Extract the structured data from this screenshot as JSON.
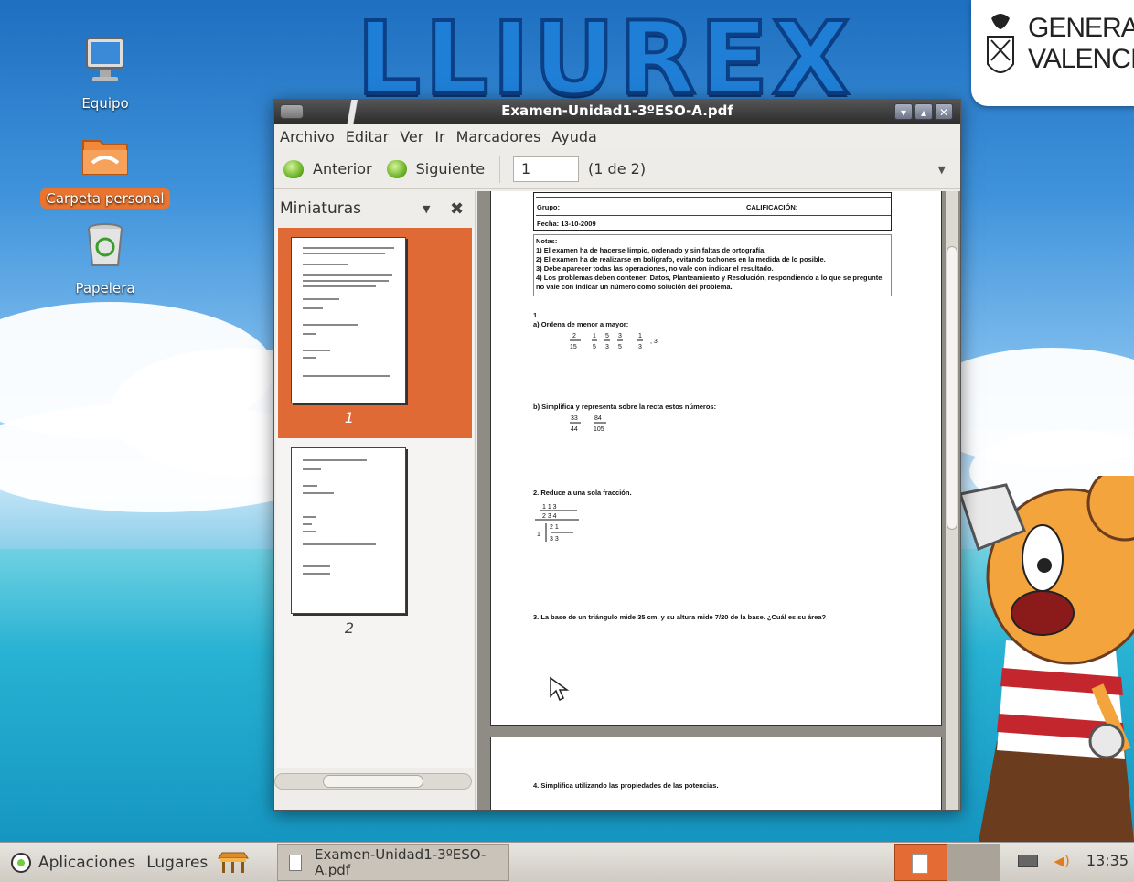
{
  "desktop": {
    "icons": [
      {
        "name": "equipo",
        "label": "Equipo"
      },
      {
        "name": "carpeta-personal",
        "label": "Carpeta personal"
      },
      {
        "name": "papelera",
        "label": "Papelera"
      }
    ],
    "logo_text": "LLIUREX",
    "gva_line1": "GENERALIT",
    "gva_line2": "VALENCIAN"
  },
  "window": {
    "title": "Examen-Unidad1-3ºESO-A.pdf",
    "controls": [
      "minimize",
      "maximize",
      "close"
    ],
    "menu": [
      "Archivo",
      "Editar",
      "Ver",
      "Ir",
      "Marcadores",
      "Ayuda"
    ],
    "toolbar": {
      "prev_label": "Anterior",
      "next_label": "Siguiente",
      "page_value": "1",
      "page_count": "(1 de 2)"
    },
    "sidebar": {
      "title": "Miniaturas",
      "thumbnails": [
        {
          "number": "1",
          "selected": true
        },
        {
          "number": "2",
          "selected": false
        }
      ]
    },
    "document": {
      "grupo_label": "Grupo:",
      "calificacion_label": "CALIFICACIÓN:",
      "fecha_label": "Fecha: 13-10-2009",
      "notas_title": "Notas:",
      "notas": [
        "1) El examen ha de hacerse limpio, ordenado y sin faltas de ortografía.",
        "2) El examen ha de realizarse en bolígrafo, evitando tachones en la medida de lo posible.",
        "3) Debe aparecer todas las operaciones, no vale con indicar el resultado.",
        "4) Los problemas deben contener: Datos, Planteamiento y Resolución, respondiendo a lo que se pregunte, no vale con indicar un número como solución del problema."
      ],
      "q1_num": "1.",
      "q1a": "a)  Ordena de menor a mayor:",
      "q1b": "b)  Simplifica y representa sobre la recta estos números:",
      "q2": "2. Reduce a una sola fracción.",
      "q3": "3. La base de un triángulo mide  35 cm,  y su altura mide  7/20  de la base. ¿Cuál es su área?",
      "q4": "4. Simplifica utilizando las propiedades de las potencias."
    }
  },
  "taskbar": {
    "apps_label": "Aplicaciones",
    "places_label": "Lugares",
    "task_title": "Examen-Unidad1-3ºESO-A.pdf",
    "clock": "13:35"
  },
  "colors": {
    "accent": "#e06a36",
    "selection": "#e8742f"
  }
}
